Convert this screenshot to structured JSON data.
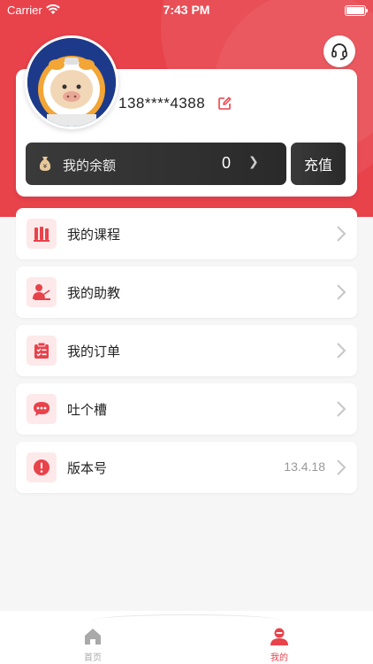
{
  "status_bar": {
    "carrier": "Carrier",
    "time": "7:43 PM"
  },
  "profile": {
    "phone": "138****4388"
  },
  "balance": {
    "label": "我的余额",
    "amount": "0",
    "recharge_label": "充值"
  },
  "menu": [
    {
      "label": "我的课程",
      "icon": "books-icon",
      "value": ""
    },
    {
      "label": "我的助教",
      "icon": "teacher-icon",
      "value": ""
    },
    {
      "label": "我的订单",
      "icon": "clipboard-icon",
      "value": ""
    },
    {
      "label": "吐个槽",
      "icon": "chat-bubble-icon",
      "value": ""
    },
    {
      "label": "版本号",
      "icon": "info-icon",
      "value": "13.4.18"
    }
  ],
  "tabs": [
    {
      "label": "首页",
      "icon": "home-icon",
      "active": false
    },
    {
      "label": "我的",
      "icon": "profile-icon",
      "active": true
    }
  ],
  "colors": {
    "accent": "#e8424b",
    "tab_inactive": "#a9a9a9",
    "icon_bg": "#fde9ea"
  }
}
